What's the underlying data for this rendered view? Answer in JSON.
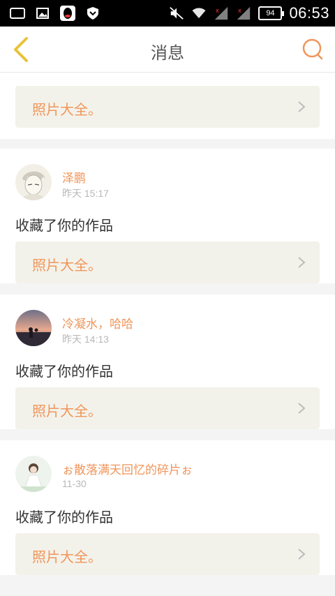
{
  "status_bar": {
    "time": "06:53",
    "battery": "94",
    "icons": [
      "screen-icon",
      "image-icon",
      "qq-icon",
      "shield-icon",
      "mute-icon",
      "wifi-icon",
      "signal-icon",
      "signal-icon",
      "battery-icon"
    ]
  },
  "header": {
    "title": "消息",
    "back_icon": "chevron-left-icon",
    "search_icon": "search-icon"
  },
  "feed": {
    "first_album": "照片大全。",
    "items": [
      {
        "user": "泽鹏",
        "time": "昨天 15:17",
        "action": "收藏了你的作品",
        "album": "照片大全。"
      },
      {
        "user": "冷凝水，哈哈",
        "time": "昨天 14:13",
        "action": "收藏了你的作品",
        "album": "照片大全。"
      },
      {
        "user": "ぉ散落满天回忆的碎片ぉ",
        "time": "11-30",
        "action": "收藏了你的作品",
        "album": "照片大全。"
      }
    ]
  },
  "colors": {
    "accent": "#f0955a",
    "back_arrow": "#e8c33a",
    "album_bg": "#f3f2ea",
    "page_bg": "#f4f4f4"
  }
}
